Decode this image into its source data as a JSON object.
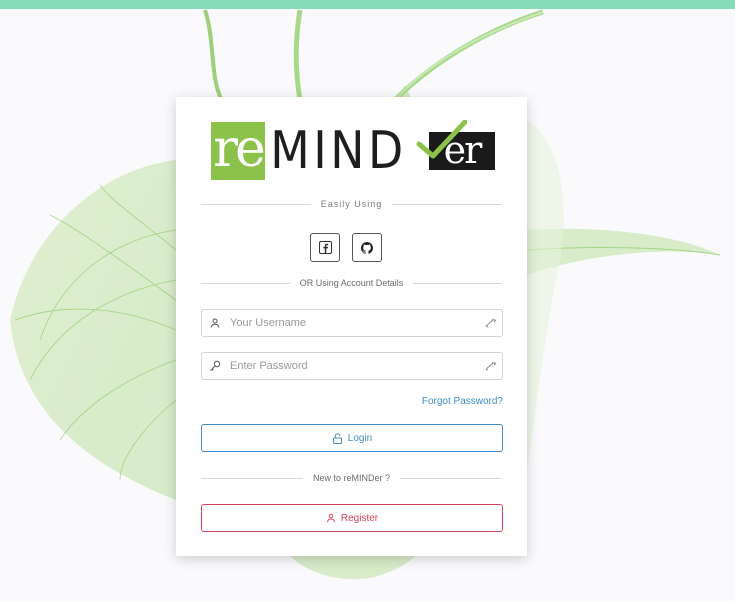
{
  "app": {
    "name": "reMINDer"
  },
  "logo": {
    "part_re": "re",
    "part_mind": "MIND",
    "part_er": "er",
    "accent": "#8bc34a",
    "dark": "#1a1a1a"
  },
  "social": {
    "heading": "Easily Using",
    "facebook_icon": "facebook-icon",
    "github_icon": "github-icon"
  },
  "account": {
    "heading": "OR Using Account Details"
  },
  "form": {
    "username_placeholder": "Your Username",
    "username_value": "",
    "password_placeholder": "Enter Password",
    "password_value": "",
    "forgot_label": "Forgot Password?",
    "login_label": "Login"
  },
  "register": {
    "heading": "New to reMINDer ?",
    "button_label": "Register"
  },
  "colors": {
    "top_bar": "#86dcb8",
    "primary": "#3f8dc9",
    "danger": "#d6415a"
  }
}
